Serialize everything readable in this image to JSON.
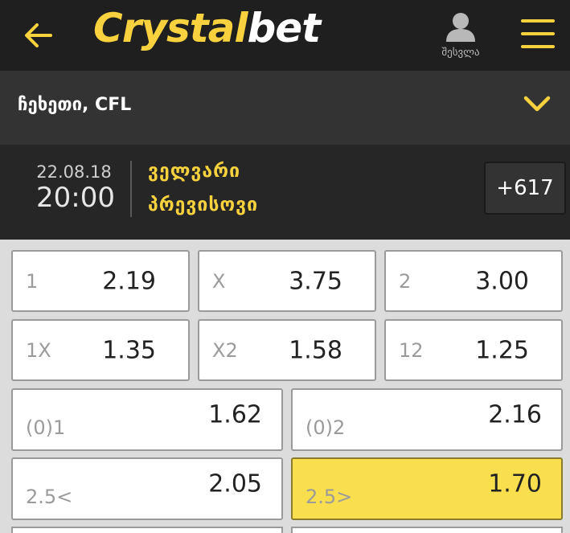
{
  "header": {
    "logo_part1": "Crystal",
    "logo_part2": "bet",
    "user_label": "შესვლა",
    "accent": "#f7d23e"
  },
  "league": {
    "title": "ჩეხეთი, CFL"
  },
  "match": {
    "date": "22.08.18",
    "time": "20:00",
    "home_team": "ველვარი",
    "away_team": "პრევისოვი",
    "more_markets": "+617"
  },
  "odds": [
    {
      "label": "1",
      "value": "2.19",
      "selected": false
    },
    {
      "label": "X",
      "value": "3.75",
      "selected": false
    },
    {
      "label": "2",
      "value": "3.00",
      "selected": false
    },
    {
      "label": "1X",
      "value": "1.35",
      "selected": false
    },
    {
      "label": "X2",
      "value": "1.58",
      "selected": false
    },
    {
      "label": "12",
      "value": "1.25",
      "selected": false
    },
    {
      "label": "(0)1",
      "value": "1.62",
      "selected": false
    },
    {
      "label": "(0)2",
      "value": "2.16",
      "selected": false
    },
    {
      "label": "2.5<",
      "value": "2.05",
      "selected": false
    },
    {
      "label": "2.5>",
      "value": "1.70",
      "selected": true
    }
  ],
  "icons": [
    "back-arrow-icon",
    "user-icon",
    "hamburger-menu-icon",
    "chevron-down-icon"
  ]
}
